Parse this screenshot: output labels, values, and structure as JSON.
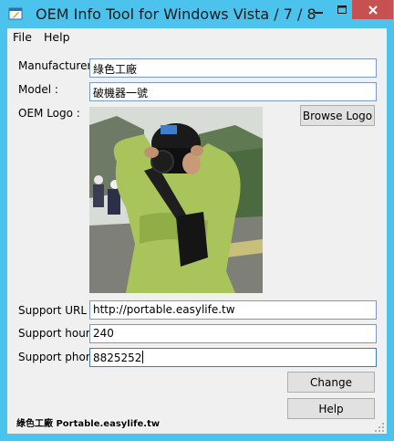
{
  "window": {
    "title": "OEM Info Tool for Windows Vista / 7 / 8"
  },
  "menu": {
    "file": "File",
    "help": "Help"
  },
  "form": {
    "manufacturer_label": "Manufacturer :",
    "manufacturer_value": "綠色工廠",
    "model_label": "Model :",
    "model_value": "破機器一號",
    "logo_label": "OEM Logo :",
    "browse_button": "Browse Logo",
    "support_url_label": "Support URL :",
    "support_url_value": "http://portable.easylife.tw",
    "support_hours_label": "Support hours :",
    "support_hours_value": "240",
    "support_phone_label": "Support phone :",
    "support_phone_value": "8825252"
  },
  "actions": {
    "change": "Change",
    "help": "Help"
  },
  "watermark": "綠色工廠 Portable.easylife.tw",
  "colors": {
    "titlebar": "#4cc3ec",
    "close_button": "#c75050",
    "client_bg": "#f0f0f0"
  }
}
